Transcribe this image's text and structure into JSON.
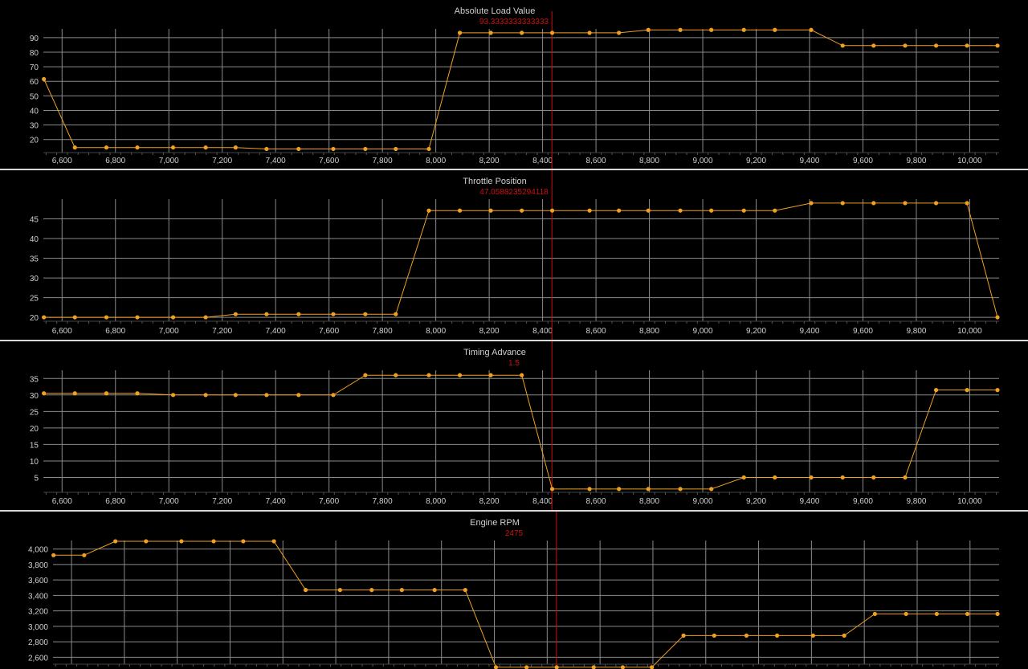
{
  "colors": {
    "background": "#000000",
    "grid": "#8a8a8a",
    "series": "#f0a020",
    "cursor": "#cc1010",
    "text": "#d0d0d0",
    "separator": "#d8d8d8"
  },
  "chart_data": [
    {
      "type": "line",
      "title": "Absolute Load Value",
      "cursor_label": "93.3333333333333",
      "cursor_x": 8435,
      "xlim": [
        6530,
        10110
      ],
      "ylim": [
        11,
        96
      ],
      "y_ticks": [
        20,
        30,
        40,
        50,
        60,
        70,
        80,
        90
      ],
      "x_ticks": [
        6600,
        6800,
        7000,
        7200,
        7400,
        7600,
        7800,
        8000,
        8200,
        8400,
        8600,
        8800,
        9000,
        9200,
        9400,
        9600,
        9800,
        10000
      ],
      "x_tick_labels": [
        "6,600",
        "6,800",
        "7,000",
        "7,200",
        "7,400",
        "7,600",
        "7,800",
        "8,000",
        "8,200",
        "8,400",
        "8,600",
        "8,800",
        "9,000",
        "9,200",
        "9,400",
        "9,600",
        "9,800",
        "10,000"
      ],
      "grid": true,
      "series": [
        {
          "x": [
            6532,
            6648,
            6766,
            6882,
            7016,
            7138,
            7250,
            7366,
            7486,
            7616,
            7736,
            7850,
            7974,
            8090,
            8206,
            8322,
            8436,
            8576,
            8686,
            8796,
            8916,
            9032,
            9154,
            9270,
            9406,
            9524,
            9640,
            9758,
            9874,
            9990,
            10104
          ],
          "y": [
            61.5,
            14.5,
            14.5,
            14.5,
            14.5,
            14.5,
            14.5,
            13.5,
            13.5,
            13.5,
            13.5,
            13.5,
            13.5,
            93.3,
            93.3,
            93.3,
            93.3,
            93.3,
            93.3,
            95.3,
            95.3,
            95.3,
            95.3,
            95.3,
            95.3,
            84.5,
            84.5,
            84.5,
            84.5,
            84.5,
            84.5
          ]
        }
      ]
    },
    {
      "type": "line",
      "title": "Throttle Position",
      "cursor_label": "47.0588235294118",
      "cursor_x": 8435,
      "xlim": [
        6530,
        10110
      ],
      "ylim": [
        19,
        50
      ],
      "y_ticks": [
        20,
        25,
        30,
        35,
        40,
        45
      ],
      "x_ticks": [
        6600,
        6800,
        7000,
        7200,
        7400,
        7600,
        7800,
        8000,
        8200,
        8400,
        8600,
        8800,
        9000,
        9200,
        9400,
        9600,
        9800,
        10000
      ],
      "x_tick_labels": [
        "6,600",
        "6,800",
        "7,000",
        "7,200",
        "7,400",
        "7,600",
        "7,800",
        "8,000",
        "8,200",
        "8,400",
        "8,600",
        "8,800",
        "9,000",
        "9,200",
        "9,400",
        "9,600",
        "9,800",
        "10,000"
      ],
      "grid": true,
      "series": [
        {
          "x": [
            6532,
            6648,
            6766,
            6882,
            7016,
            7138,
            7250,
            7366,
            7486,
            7616,
            7736,
            7850,
            7974,
            8090,
            8206,
            8322,
            8436,
            8576,
            8686,
            8796,
            8916,
            9032,
            9154,
            9270,
            9406,
            9524,
            9640,
            9758,
            9874,
            9990,
            10104
          ],
          "y": [
            20,
            20,
            20,
            20,
            20,
            20,
            20.8,
            20.8,
            20.8,
            20.8,
            20.8,
            20.8,
            47.1,
            47.1,
            47.1,
            47.1,
            47.1,
            47.1,
            47.1,
            47.1,
            47.1,
            47.1,
            47.1,
            47.1,
            49,
            49,
            49,
            49,
            49,
            49,
            20
          ]
        }
      ]
    },
    {
      "type": "line",
      "title": "Timing Advance",
      "cursor_label": "1.5",
      "cursor_x": 8435,
      "xlim": [
        6530,
        10110
      ],
      "ylim": [
        0.5,
        37.5
      ],
      "y_ticks": [
        5,
        10,
        15,
        20,
        25,
        30,
        35
      ],
      "x_ticks": [
        6600,
        6800,
        7000,
        7200,
        7400,
        7600,
        7800,
        8000,
        8200,
        8400,
        8600,
        8800,
        9000,
        9200,
        9400,
        9600,
        9800,
        10000
      ],
      "x_tick_labels": [
        "6,600",
        "6,800",
        "7,000",
        "7,200",
        "7,400",
        "7,600",
        "7,800",
        "8,000",
        "8,200",
        "8,400",
        "8,600",
        "8,800",
        "9,000",
        "9,200",
        "9,400",
        "9,600",
        "9,800",
        "10,000"
      ],
      "grid": true,
      "series": [
        {
          "x": [
            6532,
            6648,
            6766,
            6882,
            7016,
            7138,
            7250,
            7366,
            7486,
            7616,
            7736,
            7850,
            7974,
            8090,
            8206,
            8322,
            8436,
            8576,
            8686,
            8796,
            8916,
            9032,
            9154,
            9270,
            9406,
            9524,
            9640,
            9758,
            9874,
            9990,
            10104
          ],
          "y": [
            30.5,
            30.5,
            30.5,
            30.5,
            30,
            30,
            30,
            30,
            30,
            30,
            36,
            36,
            36,
            36,
            36,
            36,
            1.5,
            1.5,
            1.5,
            1.5,
            1.5,
            1.5,
            5,
            5,
            5,
            5,
            5,
            5,
            31.5,
            31.5,
            31.5
          ]
        }
      ]
    },
    {
      "type": "line",
      "title": "Engine RPM",
      "cursor_label": "2475",
      "cursor_x": 8435,
      "xlim": [
        6530,
        10110
      ],
      "ylim": [
        2510,
        4110
      ],
      "y_ticks": [
        2600,
        2800,
        3000,
        3200,
        3400,
        3600,
        3800,
        4000
      ],
      "y_tick_labels": [
        "2,600",
        "2,800",
        "3,000",
        "3,200",
        "3,400",
        "3,600",
        "3,800",
        "4,000"
      ],
      "grid": true,
      "series": [
        {
          "x": [
            6532,
            6648,
            6766,
            6882,
            7016,
            7138,
            7250,
            7366,
            7486,
            7616,
            7736,
            7850,
            7974,
            8090,
            8206,
            8322,
            8436,
            8576,
            8686,
            8796,
            8916,
            9032,
            9154,
            9270,
            9406,
            9524,
            9640,
            9758,
            9874,
            9990,
            10104
          ],
          "y": [
            3920,
            3920,
            4100,
            4100,
            4100,
            4100,
            4100,
            4100,
            3470,
            3470,
            3470,
            3470,
            3470,
            3470,
            2470,
            2470,
            2470,
            2470,
            2470,
            2470,
            2880,
            2880,
            2880,
            2880,
            2880,
            2880,
            3160,
            3160,
            3160,
            3160,
            3160
          ]
        }
      ]
    }
  ]
}
